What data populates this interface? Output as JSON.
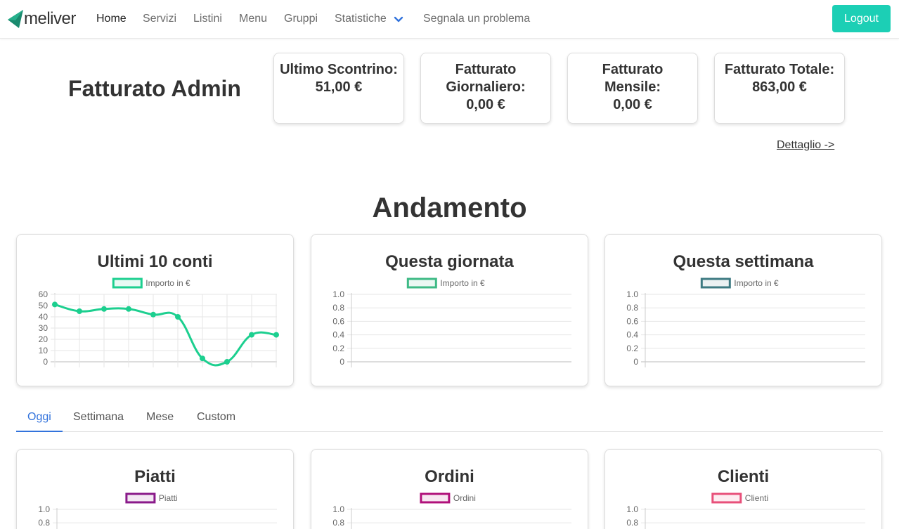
{
  "brand": {
    "name": "meliver",
    "accent": "#1ccfb5"
  },
  "nav": {
    "items": [
      "Home",
      "Servizi",
      "Listini",
      "Menu",
      "Gruppi",
      "Statistiche",
      "Segnala un problema"
    ],
    "active": "Home",
    "dropdown_icon": "chevron-down-icon",
    "logout": "Logout"
  },
  "fatturato": {
    "title": "Fatturato Admin",
    "cards": [
      {
        "label": "Ultimo Scontrino:",
        "value": "51,00 €"
      },
      {
        "label": "Fatturato Giornaliero:",
        "value": "0,00 €"
      },
      {
        "label": "Fatturato Mensile:",
        "value": "0,00 €"
      },
      {
        "label": "Fatturato Totale:",
        "value": "863,00 €"
      }
    ],
    "detail_link": "Dettaglio ->"
  },
  "andamento": {
    "title": "Andamento"
  },
  "tabs": {
    "items": [
      "Oggi",
      "Settimana",
      "Mese",
      "Custom"
    ],
    "active": "Oggi"
  },
  "chart_data": [
    {
      "type": "line",
      "title": "Ultimi 10 conti",
      "series": [
        {
          "name": "Importo in €",
          "values": [
            51,
            45,
            47,
            47,
            42,
            40,
            3,
            0,
            24,
            24
          ],
          "color": "#1ccf8f"
        }
      ],
      "ylim": [
        0,
        60
      ],
      "yticks": [
        "60",
        "50",
        "40",
        "30",
        "20",
        "10",
        "0"
      ],
      "grid": true,
      "legend": "top"
    },
    {
      "type": "line",
      "title": "Questa giornata",
      "series": [
        {
          "name": "Importo in €",
          "values": [],
          "color": "#3dba85"
        }
      ],
      "ylim": [
        0,
        1.0
      ],
      "yticks": [
        "1.0",
        "0.8",
        "0.6",
        "0.4",
        "0.2",
        "0"
      ],
      "grid": true,
      "legend": "top"
    },
    {
      "type": "line",
      "title": "Questa settimana",
      "series": [
        {
          "name": "Importo in €",
          "values": [],
          "color": "#3d7a82"
        }
      ],
      "ylim": [
        0,
        1.0
      ],
      "yticks": [
        "1.0",
        "0.8",
        "0.6",
        "0.4",
        "0.2",
        "0"
      ],
      "grid": true,
      "legend": "top"
    },
    {
      "type": "line",
      "title": "Piatti",
      "series": [
        {
          "name": "Piatti",
          "values": [],
          "color": "#8a1a8a"
        }
      ],
      "ylim": [
        0,
        1.0
      ],
      "yticks": [
        "1.0",
        "0.8"
      ],
      "grid": true,
      "legend": "top"
    },
    {
      "type": "line",
      "title": "Ordini",
      "series": [
        {
          "name": "Ordini",
          "values": [],
          "color": "#b0107a"
        }
      ],
      "ylim": [
        0,
        1.0
      ],
      "yticks": [
        "1.0",
        "0.8"
      ],
      "grid": true,
      "legend": "top"
    },
    {
      "type": "line",
      "title": "Clienti",
      "series": [
        {
          "name": "Clienti",
          "values": [],
          "color": "#e8507a"
        }
      ],
      "ylim": [
        0,
        1.0
      ],
      "yticks": [
        "1.0",
        "0.8"
      ],
      "grid": true,
      "legend": "top"
    }
  ]
}
